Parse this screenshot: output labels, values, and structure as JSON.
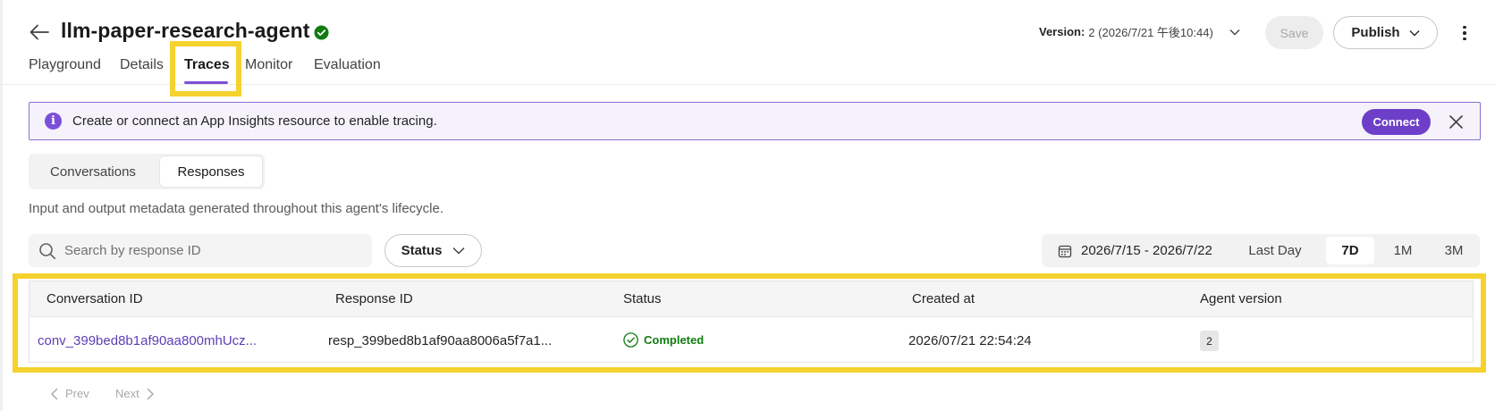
{
  "header": {
    "title": "llm-paper-research-agent",
    "version_label": "Version:",
    "version_value": "2 (2026/7/21 午後10:44)",
    "save_label": "Save",
    "publish_label": "Publish"
  },
  "tabs": [
    {
      "label": "Playground"
    },
    {
      "label": "Details"
    },
    {
      "label": "Traces"
    },
    {
      "label": "Monitor"
    },
    {
      "label": "Evaluation"
    }
  ],
  "active_tab": "Traces",
  "banner": {
    "text": "Create or connect an App Insights resource to enable tracing.",
    "connect_label": "Connect"
  },
  "view_toggle": {
    "conversations_label": "Conversations",
    "responses_label": "Responses",
    "selected": "Responses"
  },
  "description": "Input and output metadata generated throughout this agent's lifecycle.",
  "filters": {
    "search_placeholder": "Search by response ID",
    "status_label": "Status",
    "date_range": "2026/7/15 - 2026/7/22",
    "range_options": [
      {
        "label": "Last Day"
      },
      {
        "label": "7D"
      },
      {
        "label": "1M"
      },
      {
        "label": "3M"
      }
    ],
    "selected_range": "7D"
  },
  "table": {
    "columns": [
      "Conversation ID",
      "Response ID",
      "Status",
      "Created at",
      "Agent version"
    ],
    "rows": [
      {
        "conversation_id": "conv_399bed8b1af90aa800mhUcz...",
        "response_id": "resp_399bed8b1af90aa8006a5f7a1...",
        "status": "Completed",
        "created_at": "2026/07/21 22:54:24",
        "agent_version": "2"
      }
    ]
  },
  "pagination": {
    "prev_label": "Prev",
    "next_label": "Next"
  },
  "colors": {
    "accent": "#6d3fc8",
    "highlight": "#f5d22e",
    "success": "#107c10",
    "link": "#5b3fb5"
  }
}
